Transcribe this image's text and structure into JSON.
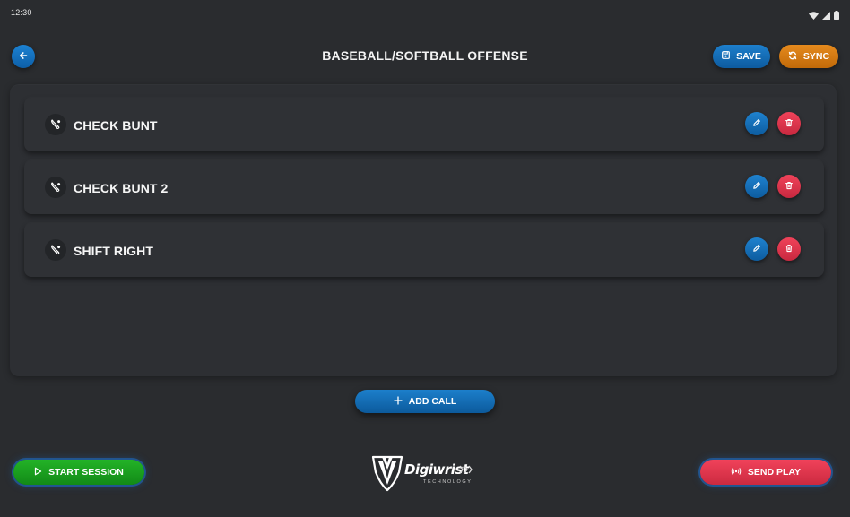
{
  "status_bar": {
    "time": "12:30",
    "icons": [
      "wifi-icon",
      "cellular-signal-icon",
      "battery-icon"
    ]
  },
  "header": {
    "back_icon": "arrow-left-icon",
    "title": "BASEBALL/SOFTBALL OFFENSE",
    "save_label": "SAVE",
    "save_icon": "floppy-disk-icon",
    "sync_label": "SYNC",
    "sync_icon": "refresh-icon"
  },
  "calls": [
    {
      "label": "CHECK BUNT",
      "icon": "bat-ball-icon"
    },
    {
      "label": "CHECK BUNT 2",
      "icon": "bat-ball-icon"
    },
    {
      "label": "SHIFT RIGHT",
      "icon": "bat-ball-icon"
    }
  ],
  "row_actions": {
    "edit_icon": "pencil-icon",
    "delete_icon": "trash-icon"
  },
  "add_call": {
    "label": "ADD CALL",
    "icon": "plus-icon"
  },
  "footer": {
    "start_session_label": "START SESSION",
    "start_session_icon": "play-outline-icon",
    "send_play_label": "SEND PLAY",
    "send_play_icon": "broadcast-icon",
    "brand_name": "Digiwrist",
    "brand_tagline": "TECHNOLOGY"
  },
  "colors": {
    "background": "#2a2c2f",
    "panel": "#2d2f33",
    "primary_blue": "#1479c4",
    "sync_orange": "#d97d12",
    "delete_red": "#e63950",
    "start_green": "#1ea122",
    "send_red": "#e63650"
  }
}
